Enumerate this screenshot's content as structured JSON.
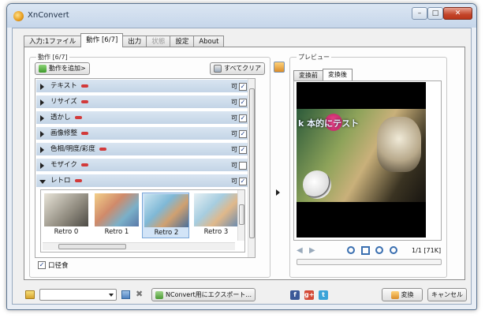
{
  "window": {
    "title": "XnConvert",
    "min_label": "–",
    "max_label": "□",
    "close_label": "✕"
  },
  "tabs": [
    {
      "label": "入力:1ファイル",
      "state": "normal"
    },
    {
      "label": "動作 [6/7]",
      "state": "active"
    },
    {
      "label": "出力",
      "state": "normal"
    },
    {
      "label": "状態",
      "state": "disabled"
    },
    {
      "label": "設定",
      "state": "normal"
    },
    {
      "label": "About",
      "state": "normal"
    }
  ],
  "actions_panel": {
    "group_label": "動作 [6/7]",
    "add_button": "動作を追加>",
    "clear_button": "すべてクリア",
    "ok_label": "可",
    "items": [
      {
        "name": "テキスト",
        "checked": true,
        "expanded": false
      },
      {
        "name": "リサイズ",
        "checked": true,
        "expanded": false
      },
      {
        "name": "透かし",
        "checked": true,
        "expanded": false
      },
      {
        "name": "画像修整",
        "checked": true,
        "expanded": false
      },
      {
        "name": "色相/明度/彩度",
        "checked": true,
        "expanded": false
      },
      {
        "name": "モザイク",
        "checked": false,
        "expanded": false
      },
      {
        "name": "レトロ",
        "checked": true,
        "expanded": true
      }
    ],
    "retro_presets": [
      {
        "label": "Retro 0"
      },
      {
        "label": "Retro 1"
      },
      {
        "label": "Retro 2",
        "selected": true
      },
      {
        "label": "Retro 3"
      }
    ],
    "corrosion": {
      "label": "口径食",
      "checked": true
    }
  },
  "preview": {
    "group_label": "プレビュー",
    "tabs": [
      {
        "label": "変換前"
      },
      {
        "label": "変換後",
        "active": true
      }
    ],
    "overlay_text": "k 本的にテスト",
    "page_info": "1/1 [71K]"
  },
  "bottom": {
    "export_button": "NConvert用にエクスポート...",
    "convert_button": "変換",
    "cancel_button": "キャンセル",
    "social": {
      "facebook": "f",
      "gplus": "g+",
      "twitter": "t"
    }
  },
  "colors": {
    "accent": "#c3d4e6",
    "minus_red": "#d23a3a",
    "preview_bg": "#000000"
  }
}
